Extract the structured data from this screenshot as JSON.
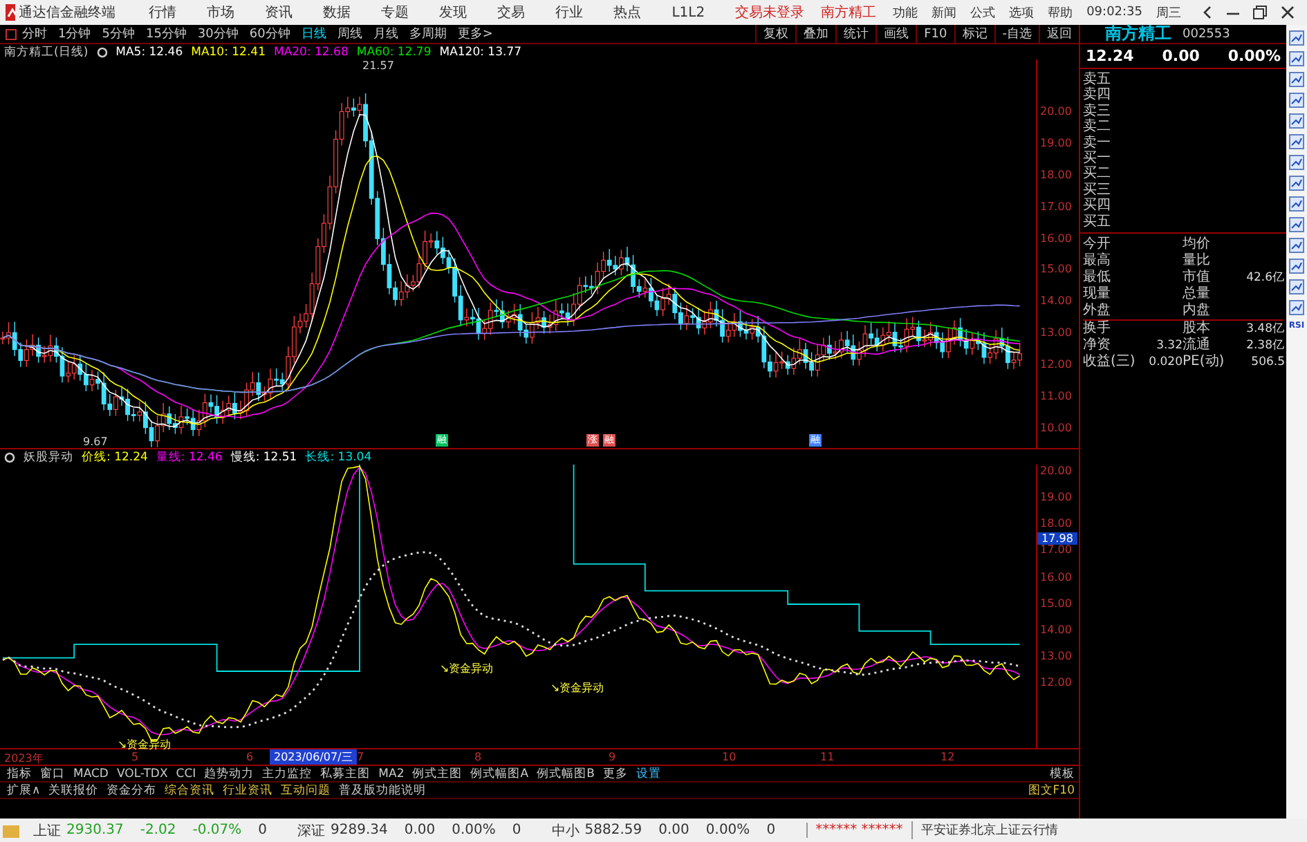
{
  "title_bar": {
    "app_name": "通达信金融终端",
    "menus": [
      "行情",
      "市场",
      "资讯",
      "数据",
      "专题",
      "发现",
      "交易",
      "行业",
      "热点",
      "L1L2"
    ],
    "login_status": "交易未登录",
    "stock_name": "南方精工",
    "right_menus": [
      "功能",
      "新闻",
      "公式",
      "选项",
      "帮助"
    ],
    "clock": "09:02:35",
    "weekday": "周三"
  },
  "period_bar": {
    "periods": [
      {
        "label": "分时",
        "selected": false
      },
      {
        "label": "1分钟",
        "selected": false
      },
      {
        "label": "5分钟",
        "selected": false
      },
      {
        "label": "15分钟",
        "selected": false
      },
      {
        "label": "30分钟",
        "selected": false
      },
      {
        "label": "60分钟",
        "selected": false
      },
      {
        "label": "日线",
        "selected": true
      },
      {
        "label": "周线",
        "selected": false
      },
      {
        "label": "月线",
        "selected": false
      },
      {
        "label": "多周期",
        "selected": false
      },
      {
        "label": "更多>",
        "selected": false
      }
    ],
    "tools": [
      "复权",
      "叠加",
      "统计",
      "画线",
      "F10",
      "标记",
      "-自选",
      "返回"
    ]
  },
  "main_chart": {
    "title": "南方精工(日线)",
    "indicators": [
      {
        "name": "MA5: 12.46",
        "color": "#ffffff"
      },
      {
        "name": "MA10: 12.41",
        "color": "#ffff00"
      },
      {
        "name": "MA20: 12.68",
        "color": "#ff00ff"
      },
      {
        "name": "MA60: 12.79",
        "color": "#00e000"
      },
      {
        "name": "MA120: 13.77",
        "color": "#ffffff"
      }
    ],
    "high_label": "21.57",
    "low_label": "9.67",
    "axis": [
      "20.00",
      "19.00",
      "18.00",
      "17.00",
      "16.00",
      "15.00",
      "14.00",
      "13.00",
      "12.00",
      "11.00",
      "10.00"
    ],
    "markers": [
      {
        "label": "融",
        "color": "#00c060"
      },
      {
        "label": "涨",
        "color": "#e05050"
      },
      {
        "label": "融",
        "color": "#e05050"
      },
      {
        "label": "融",
        "color": "#4080ff"
      }
    ]
  },
  "sub_chart": {
    "title": "妖股异动",
    "lines": [
      {
        "name": "价线: 12.24",
        "color": "#ffff00"
      },
      {
        "name": "量线: 12.46",
        "color": "#ff00ff"
      },
      {
        "name": "慢线: 12.51",
        "color": "#ffffff"
      },
      {
        "name": "长线: 13.04",
        "color": "#00e0e0"
      }
    ],
    "axis": [
      "20.00",
      "19.00",
      "18.00",
      "17.00",
      "16.00",
      "15.00",
      "14.00",
      "13.00",
      "12.00"
    ],
    "cursor_value": "17.98",
    "signals": [
      "↘资金异动",
      "↘资金异动",
      "↘资金异动"
    ]
  },
  "date_axis": {
    "labels": [
      "2023年",
      "5",
      "6",
      "7",
      "8",
      "9",
      "10",
      "11",
      "12"
    ],
    "cursor_date": "2023/06/07/三"
  },
  "indicator_tabs": [
    "指标",
    "窗口",
    "MACD",
    "VOL-TDX",
    "CCI",
    "趋势动力",
    "主力监控",
    "私募主图",
    "MA2",
    "例式主图",
    "例式幅图A",
    "例式幅图B",
    "更多",
    "设置"
  ],
  "info_tabs": [
    "扩展∧",
    "关联报价",
    "资金分布",
    "综合资讯",
    "行业资讯",
    "互动问题",
    "普及版功能说明"
  ],
  "template_button": "模板",
  "f10_button": "图文F10",
  "quote_panel": {
    "name": "南方精工",
    "code": "002553",
    "price": "12.24",
    "change": "0.00",
    "change_pct": "0.00%",
    "order_book": [
      "卖五",
      "卖四",
      "卖三",
      "卖二",
      "卖一",
      "买一",
      "买二",
      "买三",
      "买四",
      "买五"
    ],
    "stats": [
      {
        "label": "今开",
        "label2": "均价"
      },
      {
        "label": "最高",
        "label2": "量比"
      },
      {
        "label": "最低",
        "label2": "市值",
        "value2": "42.6亿"
      },
      {
        "label": "现量",
        "label2": "总量"
      },
      {
        "label": "外盘",
        "label2": "内盘"
      },
      {
        "label": "换手",
        "label2": "股本",
        "value2": "3.48亿"
      },
      {
        "label": "净资",
        "value": "3.32",
        "label2": "流通",
        "value2": "2.38亿"
      },
      {
        "label": "收益(三)",
        "value": "0.020",
        "label2": "PE(动)",
        "value2": "506.5"
      }
    ]
  },
  "side_tools": {
    "rsi_label": "RSI"
  },
  "status_bar": {
    "indices": [
      {
        "name": "上证",
        "value": "2930.37",
        "change": "-2.02",
        "pct": "-0.07%",
        "volume": "0"
      },
      {
        "name": "深证",
        "value": "9289.34",
        "change": "0.00",
        "pct": "0.00%",
        "volume": "0"
      },
      {
        "name": "中小",
        "value": "5882.59",
        "change": "0.00",
        "pct": "0.00%",
        "volume": "0"
      }
    ],
    "masked": "****** ******",
    "server": "平安证券北京上证云行情"
  }
}
